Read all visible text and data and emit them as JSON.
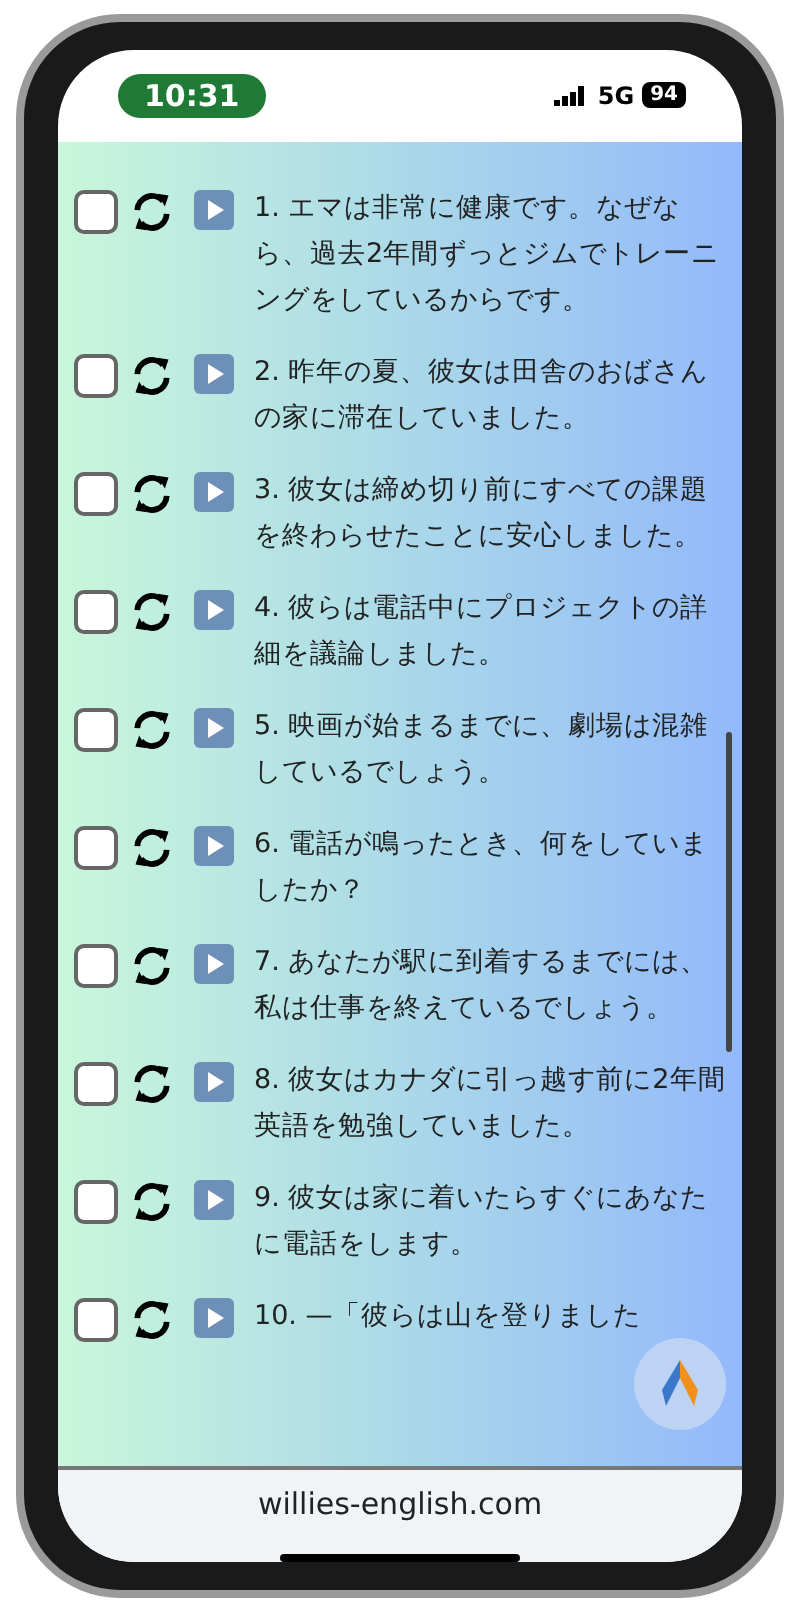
{
  "status_bar": {
    "time": "10:31",
    "network": "5G",
    "battery": "94"
  },
  "sentences": [
    {
      "text": "1. エマは非常に健康です。なぜなら、過去2年間ずっとジムでトレーニングをしているからです。",
      "checked": false
    },
    {
      "text": "2. 昨年の夏、彼女は田舎のおばさんの家に滞在していました。",
      "checked": false
    },
    {
      "text": "3. 彼女は締め切り前にすべての課題を終わらせたことに安心しました。",
      "checked": false
    },
    {
      "text": "4. 彼らは電話中にプロジェクトの詳細を議論しました。",
      "checked": false
    },
    {
      "text": "5. 映画が始まるまでに、劇場は混雑しているでしょう。",
      "checked": false
    },
    {
      "text": "6. 電話が鳴ったとき、何をしていましたか？",
      "checked": false
    },
    {
      "text": "7. あなたが駅に到着するまでには、私は仕事を終えているでしょう。",
      "checked": false
    },
    {
      "text": "8. 彼女はカナダに引っ越す前に2年間英語を勉強していました。",
      "checked": false
    },
    {
      "text": "9. 彼女は家に着いたらすぐにあなたに電話をします。",
      "checked": false
    },
    {
      "text": "10. —「彼らは山を登りました",
      "checked": false
    }
  ],
  "address_bar": {
    "url": "willies-english.com"
  }
}
